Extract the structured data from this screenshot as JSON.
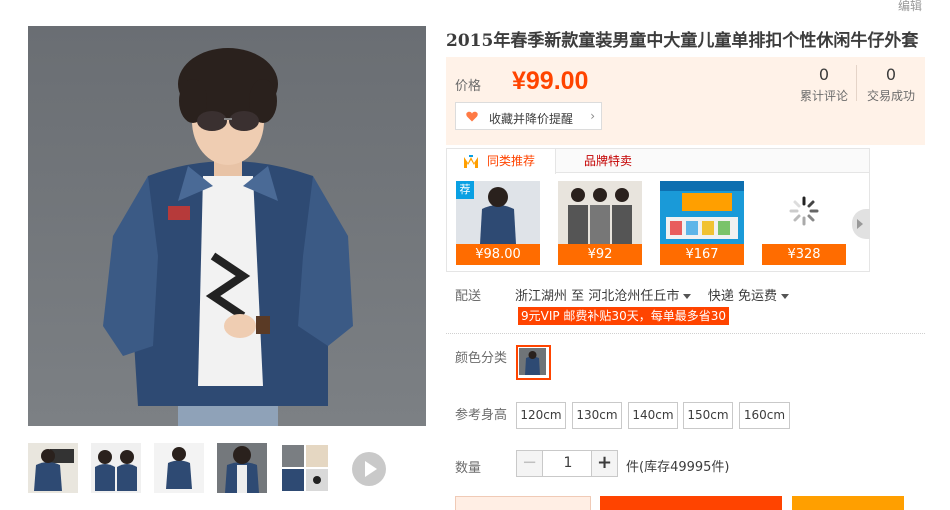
{
  "header": {
    "edit_link": "编辑"
  },
  "product": {
    "title": "2015年春季新款童装男童中大童儿童单排扣个性休闲牛仔外套"
  },
  "price": {
    "label": "价格",
    "value": "¥99.00",
    "reviews": {
      "count": "0",
      "label": "累计评论"
    },
    "sales": {
      "count": "0",
      "label": "交易成功"
    },
    "favorite_label": "收藏并降价提醒"
  },
  "recommend": {
    "tabs": [
      "同类推荐",
      "品牌特卖"
    ],
    "tag": "荐",
    "items": [
      {
        "price": "¥98.00"
      },
      {
        "price": "¥92"
      },
      {
        "price": "¥167"
      },
      {
        "price": "¥328"
      }
    ]
  },
  "delivery": {
    "label": "配送",
    "from": "浙江湖州",
    "to_word": "至",
    "to": "河北沧州任丘市",
    "method": "快递 免运费",
    "vip_note": "9元VIP 邮费补贴30天，每单最多省30"
  },
  "color": {
    "label": "颜色分类"
  },
  "size": {
    "label": "参考身高",
    "options": [
      "120cm",
      "130cm",
      "140cm",
      "150cm",
      "160cm"
    ]
  },
  "quantity": {
    "label": "数量",
    "minus": "−",
    "value": "1",
    "plus": "+",
    "stock": "件(库存49995件)"
  },
  "colors": {
    "price": "#ff4400",
    "accent_orange": "#ff6c00",
    "panel_bg": "#fff2e8"
  }
}
